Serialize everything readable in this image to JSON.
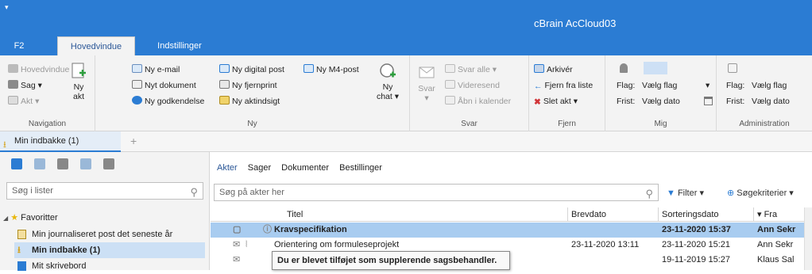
{
  "titlebar": {
    "app_title": "cBrain AcCloud03",
    "quick_access": "▾"
  },
  "tabs": [
    {
      "label": "F2"
    },
    {
      "label": "Hovedvindue"
    },
    {
      "label": "Indstillinger"
    }
  ],
  "ribbon": {
    "navigation": {
      "label": "Navigation",
      "items": [
        "Hovedvindue",
        "Sag ▾",
        "Akt ▾"
      ],
      "ny_akt": [
        "Ny",
        "akt"
      ]
    },
    "ny": {
      "label": "Ny",
      "col1": [
        "Ny e-mail",
        "Nyt dokument",
        "Ny godkendelse"
      ],
      "col2": [
        "Ny digital post",
        "Ny fjernprint",
        "Ny aktindsigt"
      ],
      "m4": "Ny M4-post",
      "chat": [
        "Ny",
        "chat ▾"
      ]
    },
    "svar": {
      "label": "Svar",
      "svar_btn": [
        "Svar",
        "▾"
      ],
      "items": [
        "Svar alle ▾",
        "Videresend",
        "Åbn i kalender"
      ]
    },
    "fjern": {
      "label": "Fjern",
      "items": [
        "Arkivér",
        "Fjern fra liste",
        "Slet akt ▾"
      ]
    },
    "mig": {
      "label": "Mig",
      "flag_label": "Flag:",
      "flag_value": "Vælg flag",
      "frist_label": "Frist:",
      "frist_value": "Vælg dato"
    },
    "administration": {
      "label": "Administration",
      "flag_label": "Flag:",
      "flag_value": "Vælg flag",
      "frist_label": "Frist:",
      "frist_value": "Vælg dato"
    }
  },
  "doc_tabs": {
    "active": "Min indbakke (1)",
    "add": "+"
  },
  "left": {
    "search_placeholder": "Søg i lister",
    "favorites_label": "Favoritter",
    "items": [
      {
        "label": "Min journaliseret post det seneste år"
      },
      {
        "label": "Min indbakke (1)"
      },
      {
        "label": "Mit skrivebord"
      }
    ]
  },
  "main": {
    "subtabs": [
      "Akter",
      "Sager",
      "Dokumenter",
      "Bestillinger"
    ],
    "search_placeholder": "Søg på akter her",
    "filter_label": "Filter ▾",
    "criteria_label": "Søgekriterier ▾",
    "columns": [
      "Titel",
      "Brevdato",
      "Sorteringsdato",
      "▾ Fra"
    ],
    "rows": [
      {
        "title": "Kravspecifikation",
        "brevdato": "",
        "sortdato": "23-11-2020 15:37",
        "fra": "Ann Sekr"
      },
      {
        "title": "Orientering om formuleseprojekt",
        "brevdato": "23-11-2020 13:11",
        "sortdato": "23-11-2020 15:21",
        "fra": "Ann Sekr"
      },
      {
        "title": "",
        "brevdato": "",
        "sortdato": "19-11-2019 15:27",
        "fra": "Klaus Sal"
      }
    ],
    "tooltip": "Du er blevet tilføjet som supplerende sagsbehandler."
  },
  "colors": {
    "accent": "#2b7cd3",
    "selection": "#a8ccf0",
    "ribbon_bg": "#f3f3f3"
  }
}
